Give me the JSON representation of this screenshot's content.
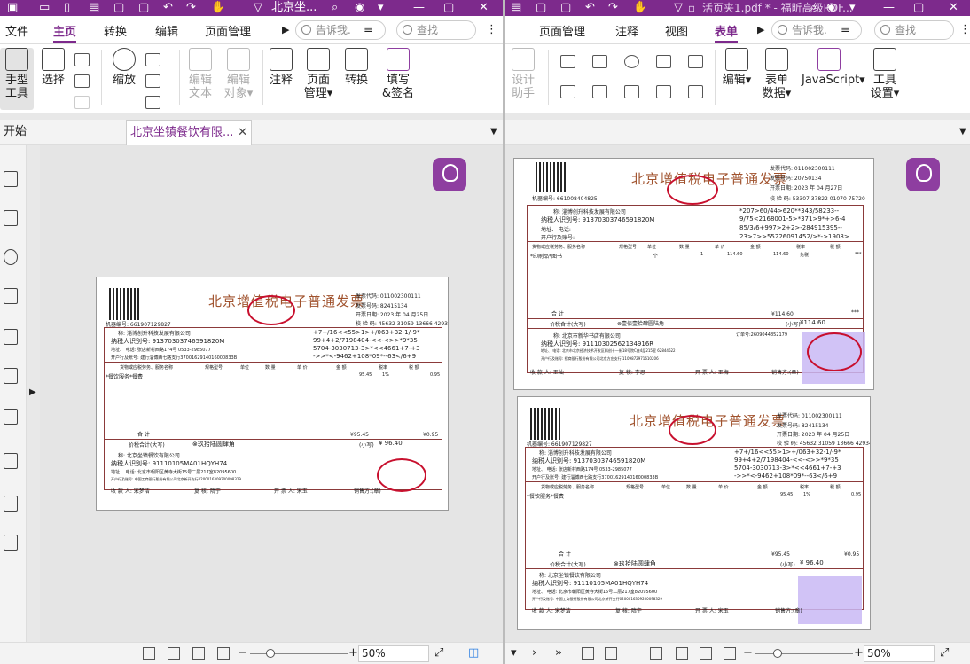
{
  "left": {
    "title": "北京坐...",
    "menu": [
      "文件",
      "主页",
      "转换",
      "编辑",
      "页面管理"
    ],
    "active_menu": "主页",
    "search_hint": "告诉我.",
    "search": "查找",
    "ribbon": [
      {
        "label": "手型\n工具",
        "icon": "hand-icon"
      },
      {
        "label": "选择",
        "icon": "select-icon"
      },
      {
        "label": "缩放",
        "icon": "zoom-icon"
      },
      {
        "label": "编辑\n文本",
        "icon": "edit-text-icon",
        "disabled": true
      },
      {
        "label": "编辑\n对象",
        "icon": "edit-object-icon",
        "disabled": true
      },
      {
        "label": "注释",
        "icon": "comment-icon"
      },
      {
        "label": "页面\n管理",
        "icon": "page-manage-icon"
      },
      {
        "label": "转换",
        "icon": "convert-icon"
      },
      {
        "label": "填写\n&签名",
        "icon": "sign-icon"
      }
    ],
    "tabs": [
      "开始",
      "北京坐镇餐饮有限..."
    ],
    "zoom": "50%"
  },
  "right": {
    "title": "活页夹1.pdf * - 福昕高级PDF...",
    "menu": [
      "页面管理",
      "注释",
      "视图",
      "表单"
    ],
    "active_menu": "表单",
    "search_hint": "告诉我.",
    "search": "查找",
    "ribbon": [
      {
        "label": "设计\n助手",
        "icon": "design-icon",
        "disabled": true
      },
      {
        "label": "编辑",
        "icon": "edit-icon"
      },
      {
        "label": "表单\n数据",
        "icon": "form-data-icon"
      },
      {
        "label": "JavaScript",
        "icon": "javascript-icon"
      },
      {
        "label": "工具\n设置",
        "icon": "tool-settings-icon"
      }
    ],
    "zoom": "50%"
  },
  "invoice_a": {
    "title": "北京增值税电子普通发票",
    "code": "发票代码: 011002300111",
    "number": "发票号码: 82415134",
    "date": "开票日期: 2023 年 04 月25日",
    "check": "校 验 码: 45632 31059 13666 42934",
    "machine": "机器编号: 661907129827",
    "buyer_name": "称: 淄博创升科技发展有限公司",
    "buyer_id": "纳税人识别号: 91370303746591820M",
    "buyer_addr": "地址、 电话: 张店新村西路174号 0533-2985077",
    "buyer_bank": "开户行及账号: 建行淄博西七路支行3700162914016000833B",
    "cipher1": "+7+/16<<55>1>+/063+32-1/-9*",
    "cipher2": "99+4+2/7198404-<<-<>>*9*35",
    "cipher3": "5704-3030713-3>*<<4661+7-+3",
    "cipher4": "->>*<-9462+108*09*--63</6+9",
    "goods_h": "货物或应税劳务、服务名称",
    "spec_h": "规格型号",
    "unit_h": "单位",
    "qty_h": "数 量",
    "price_h": "单 价",
    "amt_h": "金 额",
    "rate_h": "税率",
    "tax_h": "税 额",
    "item": "*餐饮服务*餐费",
    "amt": "95.45",
    "rate": "1%",
    "tax": "0.95",
    "sum_label": "合 计",
    "sum_amt": "¥95.45",
    "sum_tax": "¥0.95",
    "total_label": "价税合计(大写)",
    "total_cn": "⊗玖拾陆圆肆角",
    "total_small": "(小写)",
    "total": "¥ 96.40",
    "seller_name": "称: 北京坐镇餐饮有限公司",
    "seller_id": "纳税人识别号: 91110105MA01HQYH74",
    "seller_addr": "地址、 电话: 北京市朝阳区黄寺大街15号二层217室82095600",
    "seller_bank": "开户行及账号: 中国工商银行股份有限公司北京新开支行0200016309200098329",
    "payee": "收 款 人: 宋梦洁",
    "review": "复 核: 隋宁",
    "drawer": "开 票 人: 宋玉",
    "seller_sig": "销售方:(章)"
  },
  "invoice_b": {
    "title": "北京增值税电子普通发票",
    "code": "发票代码: 011002300111",
    "number": "发票号码: 20750134",
    "date": "开票日期: 2023 年 04 月27日",
    "check": "校 验 码: 53307 37822 01070 75720",
    "machine": "机器编号: 661008404825",
    "buyer_name": "称: 淄博创升科技发展有限公司",
    "buyer_id": "纳税人识别号: 91370303746591820M",
    "buyer_addr": "地址、 电话:",
    "buyer_bank": "开户行及账号:",
    "cipher1": "*207>60/44>620**343/58233--",
    "cipher2": "9/75<2168001-5>*371>9*+>6-4",
    "cipher3": "85/3/6+997>2+2>-284915395--",
    "cipher4": "23>7>>55226091452/>*->1908>",
    "goods_h": "货物或应税劳务、服务名称",
    "spec_h": "规格型号",
    "unit_h": "单位",
    "qty_h": "数 量",
    "price_h": "单 价",
    "amt_h": "金 额",
    "rate_h": "税率",
    "tax_h": "税 额",
    "item": "*印刷品*图书",
    "unit": "个",
    "qty": "1",
    "price": "114.60",
    "amt": "114.60",
    "rate": "免税",
    "tax": "***",
    "sum_label": "合 计",
    "sum_amt": "¥114.60",
    "sum_tax": "***",
    "total_label": "价税合计(大写)",
    "total_cn": "⊗壹佰壹拾肆圆陆角",
    "total_small": "(小写)",
    "total": "¥114.60",
    "seller_name": "称: 北京市新华书店有限公司",
    "seller_id": "纳税人识别号: 91110302562134916R",
    "seller_addr": "地址、 电话: 北京市北京经济技术开发区科创十一街18号院C座4层215室 62844622",
    "seller_bank": "开户行及账号: 招商银行股份有限公司北京方庄支行 1109872971610206",
    "order": "订单号:2609044852179",
    "payee": "收 款 人: 王灿",
    "review": "复 核: 李思",
    "drawer": "开 票 人: 王梅",
    "seller_sig": "销售方:(章)"
  },
  "invoice_c": {
    "title": "北京增值税电子普通发票",
    "code": "发票代码: 011002300111",
    "number": "发票号码: 82415134",
    "date": "开票日期: 2023 年 04 月25日",
    "check": "校 验 码: 45632 31059 13666 42934",
    "machine": "机器编号: 661907129827",
    "buyer_name": "称: 淄博创升科技发展有限公司",
    "buyer_id": "纳税人识别号: 91370303746591820M",
    "buyer_addr": "地址、 电话: 张店新村西路174号 0533-2985077",
    "buyer_bank": "开户行及账号: 建行淄博西七路支行3700162914016000833B",
    "cipher1": "+7+/16<<55>1>+/063+32-1/-9*",
    "cipher2": "99+4+2/7198404-<<-<>>*9*35",
    "cipher3": "5704-3030713-3>*<<4661+7-+3",
    "cipher4": "->>*<-9462+108*09*--63</6+9",
    "goods_h": "货物或应税劳务、服务名称",
    "spec_h": "规格型号",
    "unit_h": "单位",
    "qty_h": "数 量",
    "price_h": "单 价",
    "amt_h": "金 额",
    "rate_h": "税率",
    "tax_h": "税 额",
    "item": "*餐饮服务*餐费",
    "amt": "95.45",
    "rate": "1%",
    "tax": "0.95",
    "sum_label": "合 计",
    "sum_amt": "¥95.45",
    "sum_tax": "¥0.95",
    "total_label": "价税合计(大写)",
    "total_cn": "⊗玖拾陆圆肆角",
    "total_small": "(小写)",
    "total": "¥ 96.40",
    "seller_name": "称: 北京坐镇餐饮有限公司",
    "seller_id": "纳税人识别号: 91110105MA01HQYH74",
    "seller_addr": "地址、 电话: 北京市朝阳区黄寺大街15号二层217室82095600",
    "seller_bank": "开户行及账号: 中国工商银行股份有限公司北京新开支行0200016309200098329",
    "payee": "收 款 人: 宋梦洁",
    "review": "复 核: 隋宁",
    "drawer": "开 票 人: 宋玉",
    "seller_sig": "销售方:(章)"
  },
  "colors": {
    "brand": "#7d2a8c",
    "seal": "#c8102e",
    "invoice_text": "#a0522d",
    "highlight": "#c9b8f5"
  }
}
